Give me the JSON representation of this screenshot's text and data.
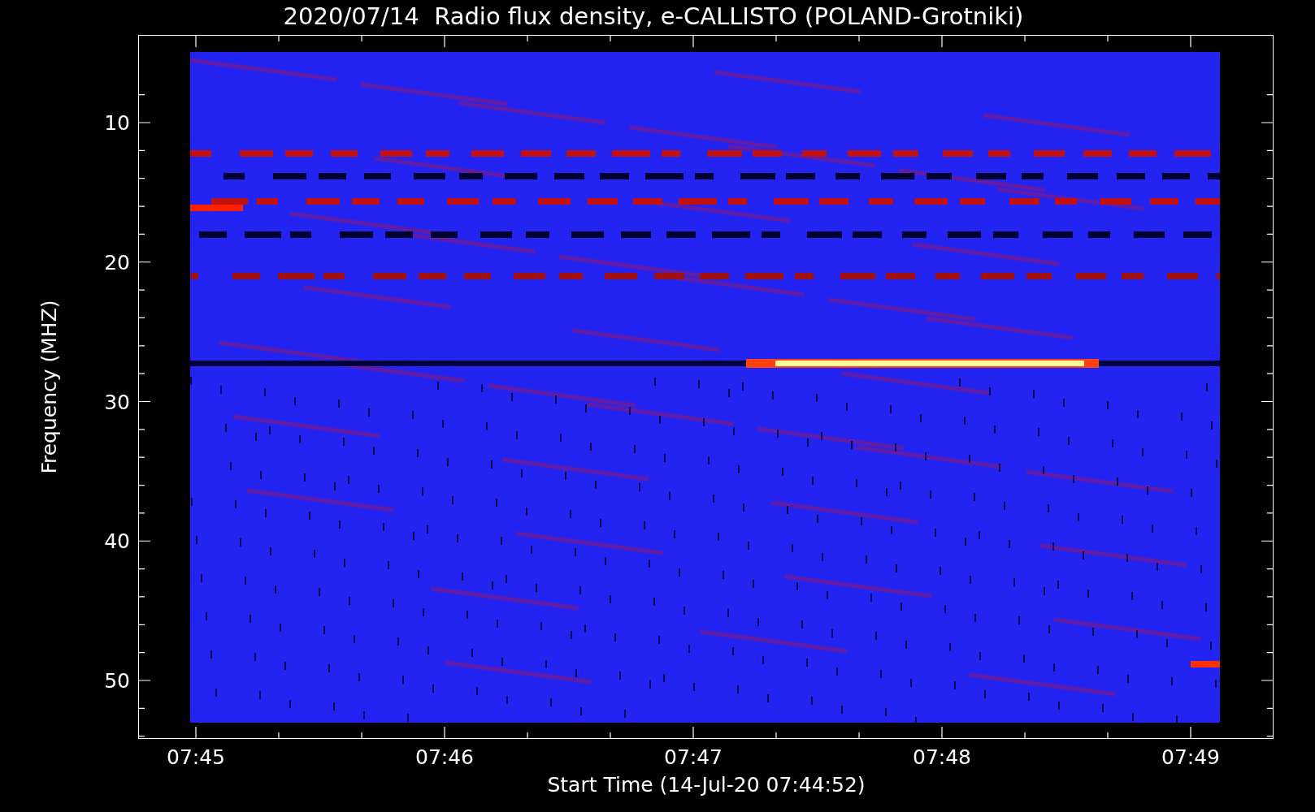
{
  "title": "2020/07/14  Radio flux density, e-CALLISTO (POLAND-Grotniki)",
  "y_axis": {
    "label": "Frequency (MHZ)",
    "ticks": [
      "10",
      "20",
      "30",
      "40",
      "50"
    ]
  },
  "x_axis": {
    "label": "Start Time (14-Jul-20 07:44:52)",
    "ticks": [
      "07:45",
      "07:46",
      "07:47",
      "07:48",
      "07:49"
    ]
  }
}
